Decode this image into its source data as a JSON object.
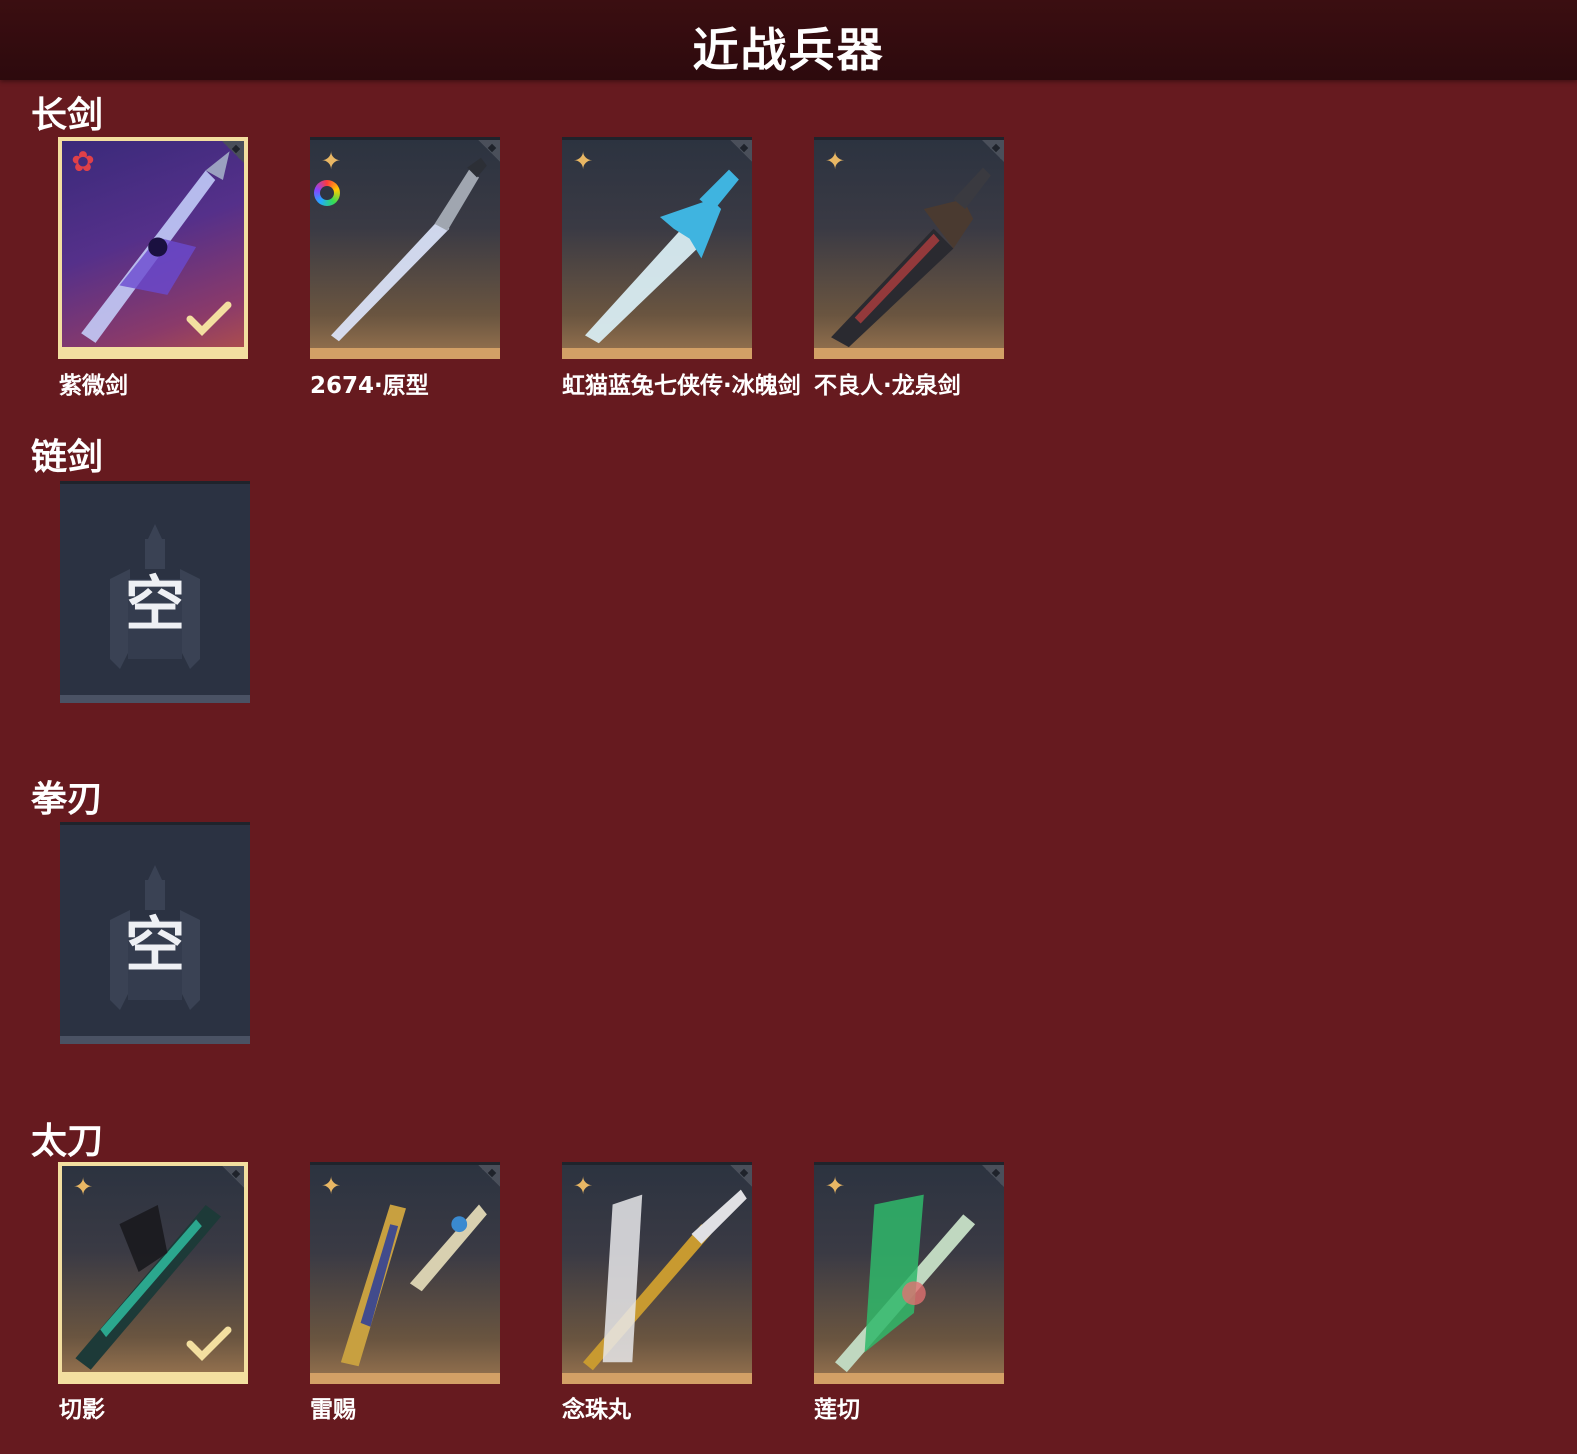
{
  "header": {
    "title": "近战兵器"
  },
  "sections": [
    {
      "title": "长剑",
      "items": [
        {
          "label": "紫微剑",
          "selected": true,
          "rarity_icon": "red-star-icon"
        },
        {
          "label": "2674·原型",
          "selected": false,
          "rarity_icon": "gold-diamond-icon",
          "extra_icon": "color-ring-icon"
        },
        {
          "label": "虹猫蓝兔七侠传·冰魄剑",
          "selected": false,
          "rarity_icon": "gold-diamond-icon"
        },
        {
          "label": "不良人·龙泉剑",
          "selected": false,
          "rarity_icon": "gold-diamond-icon"
        }
      ]
    },
    {
      "title": "链剑",
      "items": [],
      "empty_label": "空"
    },
    {
      "title": "拳刃",
      "items": [],
      "empty_label": "空"
    },
    {
      "title": "太刀",
      "items": [
        {
          "label": "切影",
          "selected": true,
          "rarity_icon": "gold-diamond-icon"
        },
        {
          "label": "雷赐",
          "selected": false,
          "rarity_icon": "gold-diamond-icon"
        },
        {
          "label": "念珠丸",
          "selected": false,
          "rarity_icon": "gold-diamond-icon"
        },
        {
          "label": "莲切",
          "selected": false,
          "rarity_icon": "gold-diamond-icon"
        }
      ]
    }
  ],
  "colors": {
    "background": "#661a1f",
    "header": "#2d0a0d",
    "selected_border": "#f3dfa0",
    "rarity_gold": "#e9b764",
    "rarity_red": "#e04048"
  }
}
